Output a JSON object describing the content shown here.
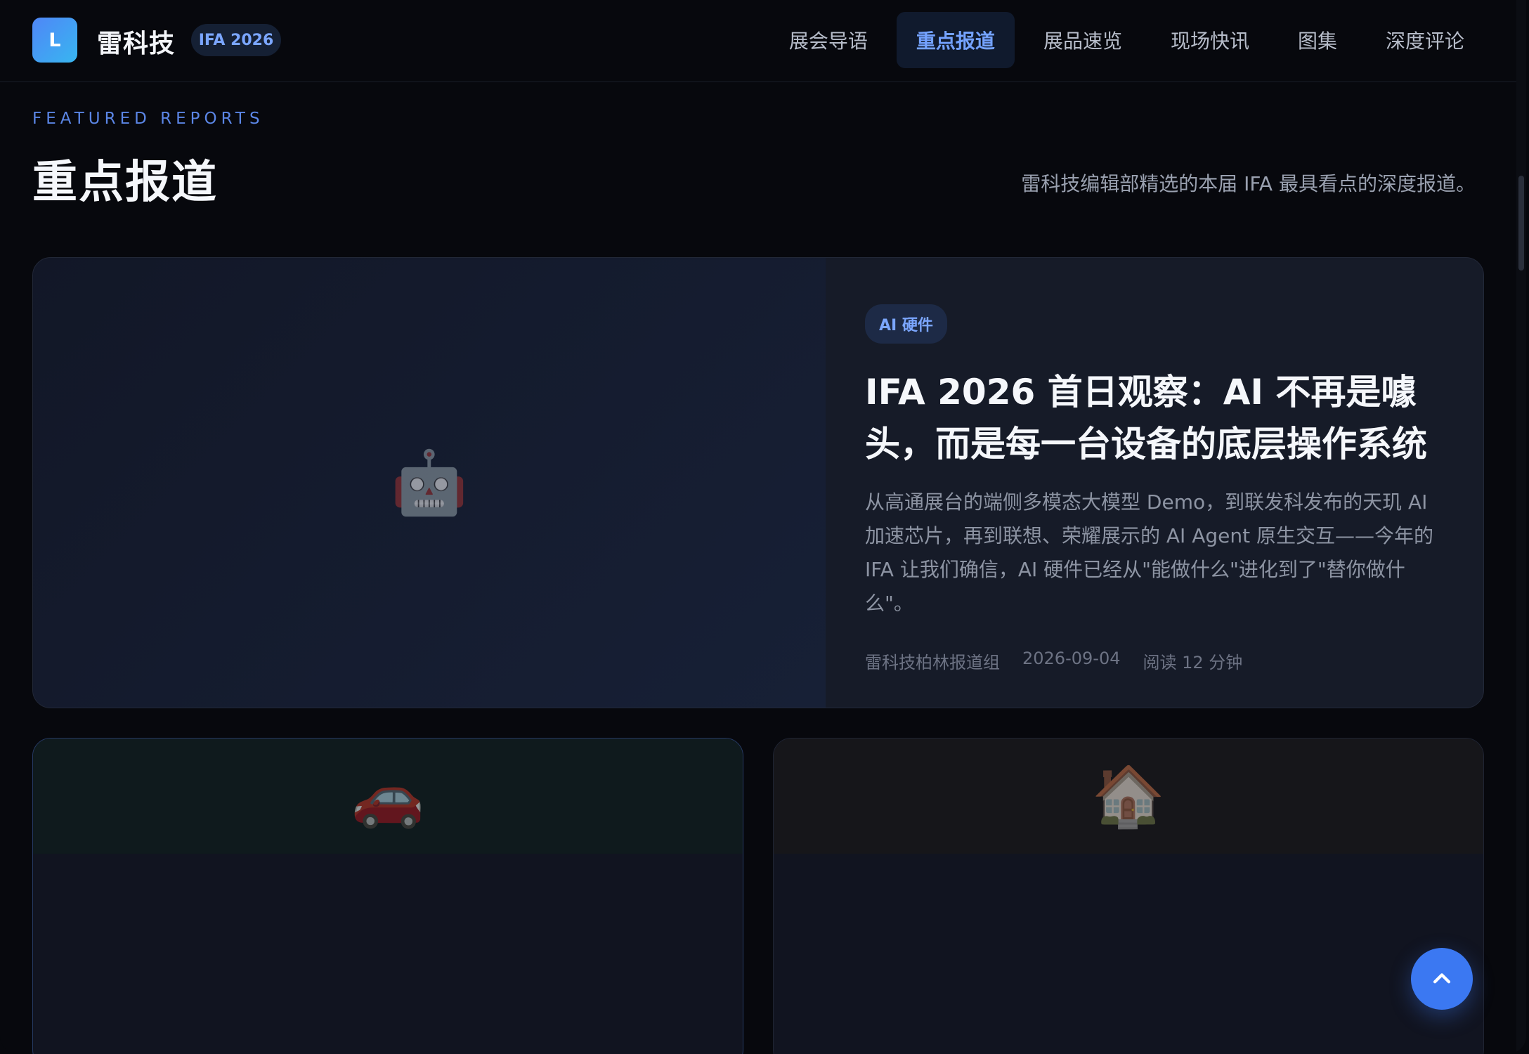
{
  "header": {
    "logo_letter": "L",
    "brand": "雷科技",
    "badge": "IFA 2026",
    "nav": [
      {
        "label": "展会导语",
        "active": false
      },
      {
        "label": "重点报道",
        "active": true
      },
      {
        "label": "展品速览",
        "active": false
      },
      {
        "label": "现场快讯",
        "active": false
      },
      {
        "label": "图集",
        "active": false
      },
      {
        "label": "深度评论",
        "active": false
      }
    ]
  },
  "section": {
    "eyebrow": "FEATURED REPORTS",
    "title": "重点报道",
    "description": "雷科技编辑部精选的本届 IFA 最具看点的深度报道。"
  },
  "featured": {
    "emoji": "🤖",
    "tag": "AI 硬件",
    "title": "IFA 2026 首日观察：AI 不再是噱头，而是每一台设备的底层操作系统",
    "summary": "从高通展台的端侧多模态大模型 Demo，到联发科发布的天玑 AI 加速芯片，再到联想、荣耀展示的 AI Agent 原生交互——今年的 IFA 让我们确信，AI 硬件已经从\"能做什么\"进化到了\"替你做什么\"。",
    "author": "雷科技柏林报道组",
    "date": "2026-09-04",
    "read_time": "阅读 12 分钟"
  },
  "cards": [
    {
      "emoji": "🚗",
      "icon": "car-icon"
    },
    {
      "emoji": "🏠",
      "icon": "house-icon"
    }
  ],
  "colors": {
    "accent": "#3b78f2",
    "background": "#07080d"
  }
}
